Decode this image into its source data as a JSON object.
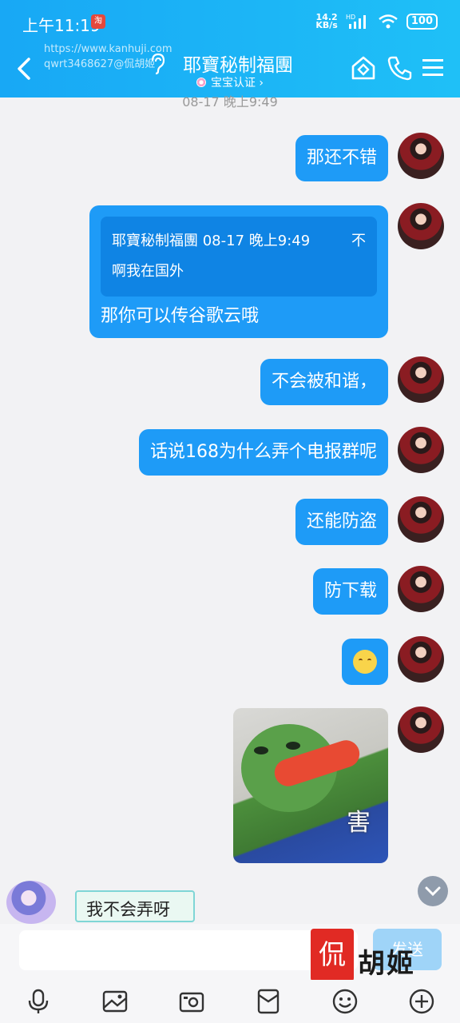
{
  "status_bar": {
    "time": "上午11:19",
    "badge_text": "淘",
    "net_speed_value": "14.2",
    "net_speed_unit": "KB/s",
    "network": "HD",
    "battery": "100"
  },
  "watermark": {
    "url": "https://www.kanhuji.com",
    "user": "qwrt3468627@侃胡姬"
  },
  "header": {
    "title": "耶寶秘制福團",
    "subtitle": "宝宝认证"
  },
  "timestamp": "08-17 晚上9:49",
  "messages": [
    {
      "text": "那还不错"
    },
    {
      "quote_sender": "耶寶秘制福團",
      "quote_time": "08-17 晚上9:49",
      "quote_line1_tail": "不",
      "quote_line2": "啊我在国外",
      "text": "那你可以传谷歌云哦"
    },
    {
      "text": "不会被和谐，"
    },
    {
      "text": "话说168为什么弄个电报群呢"
    },
    {
      "text": "还能防盗"
    },
    {
      "text": "防下载"
    },
    {
      "emoji": "pensive-face-icon"
    },
    {
      "sticker_text": "害"
    }
  ],
  "floating_sticker": {
    "text": "我不会弄呀"
  },
  "input": {
    "placeholder": "",
    "send_label": "发送"
  },
  "brand": {
    "seal": "侃",
    "text": "胡姬"
  },
  "colors": {
    "header": "#18a8f5",
    "bubble": "#1e9bf7",
    "quote": "#0f84e4",
    "background": "#f2f2f4"
  }
}
